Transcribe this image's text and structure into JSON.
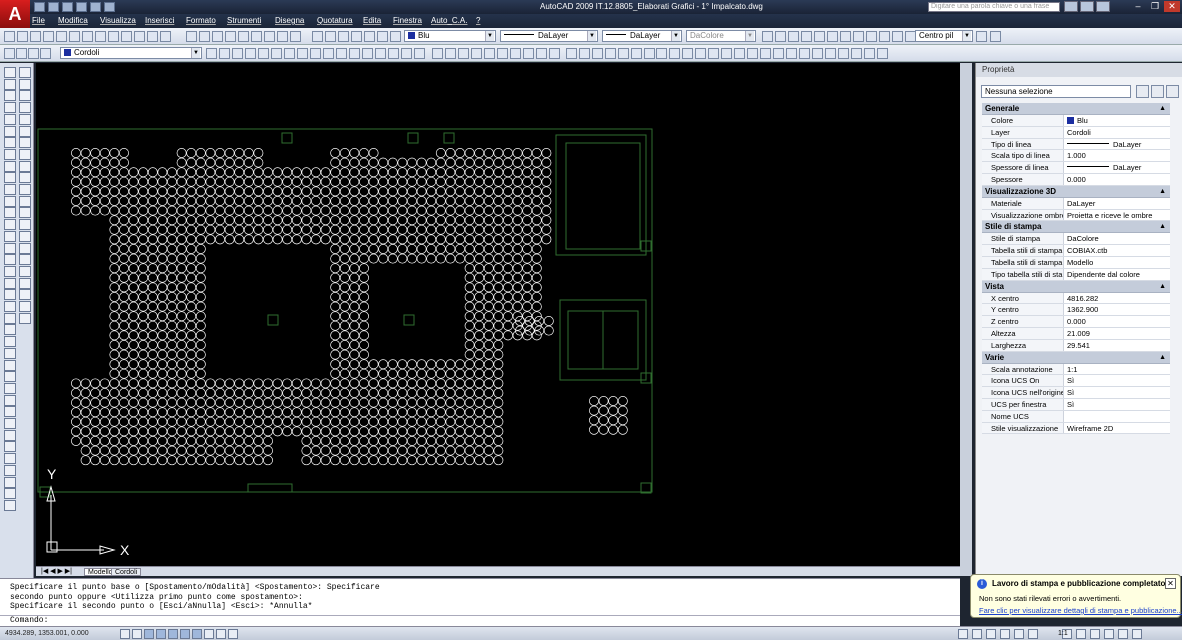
{
  "window": {
    "title": "AutoCAD 2009 IT.12.8805_Elaborati Grafici - 1° Impalcato.dwg",
    "search_placeholder": "Digitare una parola chiave o una frase",
    "logo_letter": "A",
    "minimize": "–",
    "restore": "❐",
    "close": "✕"
  },
  "menu": [
    "File",
    "Modifica",
    "Visualizza",
    "Inserisci",
    "Formato",
    "Strumenti",
    "Disegna",
    "Quotatura",
    "Edita",
    "Finestra",
    "Auto_C.A.",
    "?"
  ],
  "toolbar": {
    "color_combo": "Blu",
    "linetype_combo": "DaLayer",
    "lineweight_combo": "DaLayer",
    "plotstyle_combo": "DaColore",
    "text_style": "Centro pil",
    "layer_combo": "Cordoli"
  },
  "canvas": {
    "ucs_y": "Y",
    "ucs_x": "X",
    "colors": {
      "background": "#000000",
      "circles": "#ffffff",
      "outline": "#2f6e2f"
    }
  },
  "layout_tabs": [
    "Modello",
    "Cordoli"
  ],
  "properties": {
    "title": "Proprietà",
    "selection": "Nessuna selezione",
    "sections": [
      {
        "name": "Generale",
        "rows": [
          {
            "k": "Colore",
            "v": "Blu",
            "swatch": true
          },
          {
            "k": "Layer",
            "v": "Cordoli"
          },
          {
            "k": "Tipo di linea",
            "v": "DaLayer",
            "line": true
          },
          {
            "k": "Scala tipo di linea",
            "v": "1.000"
          },
          {
            "k": "Spessore di linea",
            "v": "DaLayer",
            "line": true
          },
          {
            "k": "Spessore",
            "v": "0.000"
          }
        ]
      },
      {
        "name": "Visualizzazione 3D",
        "rows": [
          {
            "k": "Materiale",
            "v": "DaLayer"
          },
          {
            "k": "Visualizzazione ombre",
            "v": "Proietta e riceve le ombre"
          }
        ]
      },
      {
        "name": "Stile di stampa",
        "rows": [
          {
            "k": "Stile di stampa",
            "v": "DaColore"
          },
          {
            "k": "Tabella stili di stampa",
            "v": "COBIAX.ctb"
          },
          {
            "k": "Tabella stili di stampa ...",
            "v": "Modello"
          },
          {
            "k": "Tipo tabella stili di sta...",
            "v": "Dipendente dal colore"
          }
        ]
      },
      {
        "name": "Vista",
        "rows": [
          {
            "k": "X centro",
            "v": "4816.282"
          },
          {
            "k": "Y centro",
            "v": "1362.900"
          },
          {
            "k": "Z centro",
            "v": "0.000"
          },
          {
            "k": "Altezza",
            "v": "21.009"
          },
          {
            "k": "Larghezza",
            "v": "29.541"
          }
        ]
      },
      {
        "name": "Varie",
        "rows": [
          {
            "k": "Scala annotazione",
            "v": "1:1"
          },
          {
            "k": "Icona UCS On",
            "v": "Sì"
          },
          {
            "k": "Icona UCS nell'origine",
            "v": "Sì"
          },
          {
            "k": "UCS per finestra",
            "v": "Sì"
          },
          {
            "k": "Nome UCS",
            "v": ""
          },
          {
            "k": "Stile visualizzazione",
            "v": "Wireframe 2D"
          }
        ]
      }
    ],
    "collapse_glyph": "▲"
  },
  "command": {
    "history": [
      "Specificare il punto base o [Spostamento/mOdalità] <Spostamento>: Specificare",
      "secondo punto oppure <Utilizza primo punto come spostamento>:",
      "Specificare il secondo punto o [Esci/aNnulla] <Esci>: *Annulla*"
    ],
    "prompt": "Comando:"
  },
  "status": {
    "coords": "4934.289, 1353.001, 0.000",
    "scale": "1:1"
  },
  "notification": {
    "title": "Lavoro di stampa e pubblicazione completato.",
    "body": "Non sono stati rilevati errori o avvertimenti.",
    "link": "Fare clic per visualizzare dettagli di stampa e pubblicazione...",
    "icon": "i",
    "close": "✕"
  }
}
